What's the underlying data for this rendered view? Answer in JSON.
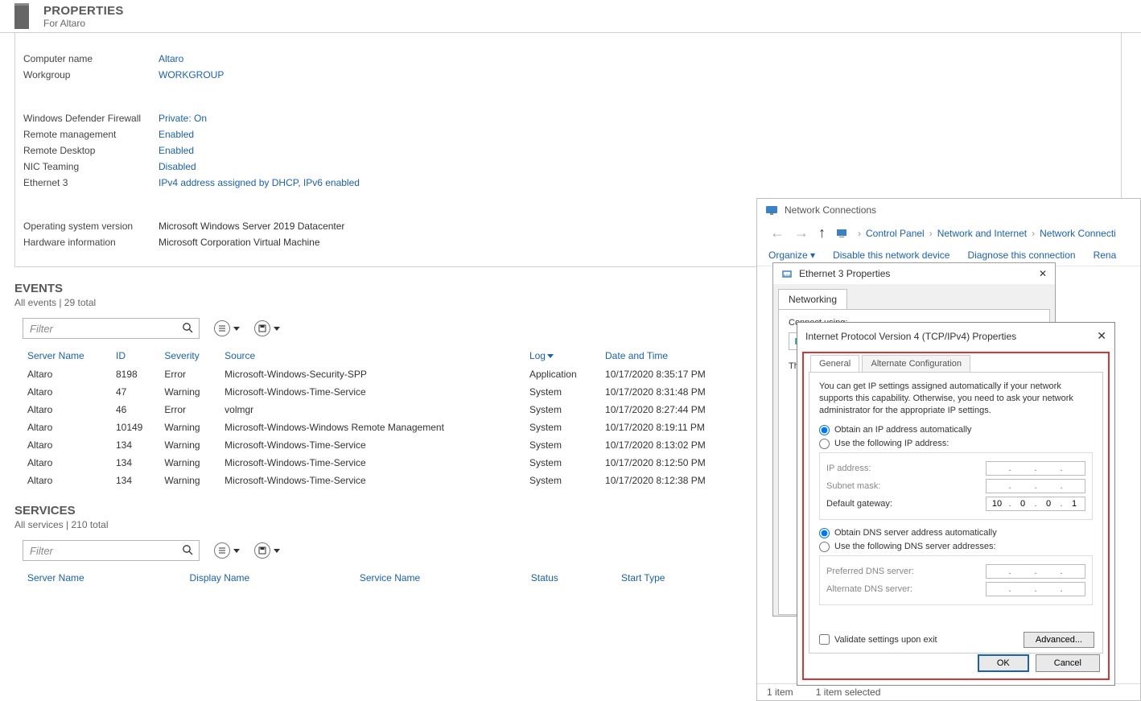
{
  "properties": {
    "title": "PROPERTIES",
    "subtitle": "For Altaro",
    "rows": [
      {
        "label": "Computer name",
        "value": "Altaro"
      },
      {
        "label": "Workgroup",
        "value": "WORKGROUP"
      }
    ],
    "rows2": [
      {
        "label": "Windows Defender Firewall",
        "value": "Private: On"
      },
      {
        "label": "Remote management",
        "value": "Enabled"
      },
      {
        "label": "Remote Desktop",
        "value": "Enabled"
      },
      {
        "label": "NIC Teaming",
        "value": "Disabled"
      },
      {
        "label": "Ethernet 3",
        "value": "IPv4 address assigned by DHCP, IPv6 enabled"
      }
    ],
    "rows3": [
      {
        "label": "Operating system version",
        "value": "Microsoft Windows Server 2019 Datacenter",
        "plain": true
      },
      {
        "label": "Hardware information",
        "value": "Microsoft Corporation Virtual Machine",
        "plain": true
      }
    ]
  },
  "events": {
    "title": "EVENTS",
    "subtitle": "All events | 29 total",
    "filter_placeholder": "Filter",
    "columns": [
      "Server Name",
      "ID",
      "Severity",
      "Source",
      "Log",
      "Date and Time"
    ],
    "rows": [
      [
        "Altaro",
        "8198",
        "Error",
        "Microsoft-Windows-Security-SPP",
        "Application",
        "10/17/2020 8:35:17 PM"
      ],
      [
        "Altaro",
        "47",
        "Warning",
        "Microsoft-Windows-Time-Service",
        "System",
        "10/17/2020 8:31:48 PM"
      ],
      [
        "Altaro",
        "46",
        "Error",
        "volmgr",
        "System",
        "10/17/2020 8:27:44 PM"
      ],
      [
        "Altaro",
        "10149",
        "Warning",
        "Microsoft-Windows-Windows Remote Management",
        "System",
        "10/17/2020 8:19:11 PM"
      ],
      [
        "Altaro",
        "134",
        "Warning",
        "Microsoft-Windows-Time-Service",
        "System",
        "10/17/2020 8:13:02 PM"
      ],
      [
        "Altaro",
        "134",
        "Warning",
        "Microsoft-Windows-Time-Service",
        "System",
        "10/17/2020 8:12:50 PM"
      ],
      [
        "Altaro",
        "134",
        "Warning",
        "Microsoft-Windows-Time-Service",
        "System",
        "10/17/2020 8:12:38 PM"
      ]
    ]
  },
  "services": {
    "title": "SERVICES",
    "subtitle": "All services | 210 total",
    "filter_placeholder": "Filter",
    "columns": [
      "Server Name",
      "Display Name",
      "Service Name",
      "Status",
      "Start Type"
    ]
  },
  "netwin": {
    "title": "Network Connections",
    "breadcrumb": [
      "Control Panel",
      "Network and Internet",
      "Network Connecti"
    ],
    "cmds": {
      "organize": "Organize ▾",
      "disable": "Disable this network device",
      "diagnose": "Diagnose this connection",
      "rename": "Rena"
    },
    "status_items": "1 item",
    "status_selected": "1 item selected"
  },
  "ethprop": {
    "title": "Ethernet 3 Properties",
    "tab": "Networking",
    "connect_label": "Connect using:"
  },
  "ipv4": {
    "title": "Internet Protocol Version 4 (TCP/IPv4) Properties",
    "tab_general": "General",
    "tab_alt": "Alternate Configuration",
    "info": "You can get IP settings assigned automatically if your network supports this capability. Otherwise, you need to ask your network administrator for the appropriate IP settings.",
    "radio_auto_ip": "Obtain an IP address automatically",
    "radio_manual_ip": "Use the following IP address:",
    "lbl_ip": "IP address:",
    "lbl_mask": "Subnet mask:",
    "lbl_gw": "Default gateway:",
    "gw_value": [
      "10",
      "0",
      "0",
      "1"
    ],
    "radio_auto_dns": "Obtain DNS server address automatically",
    "radio_manual_dns": "Use the following DNS server addresses:",
    "lbl_dns1": "Preferred DNS server:",
    "lbl_dns2": "Alternate DNS server:",
    "chk_validate": "Validate settings upon exit",
    "btn_advanced": "Advanced...",
    "btn_ok": "OK",
    "btn_cancel": "Cancel"
  }
}
